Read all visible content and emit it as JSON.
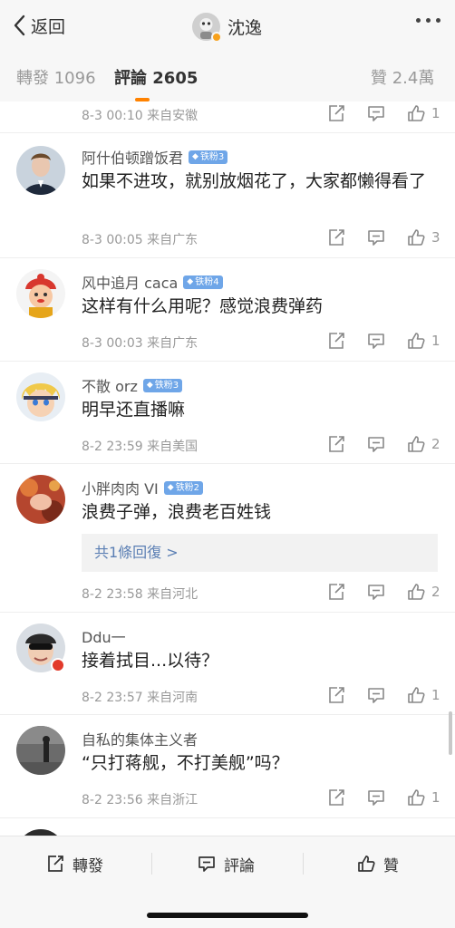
{
  "header": {
    "back_label": "返回",
    "title": "沈逸"
  },
  "tabs": [
    {
      "label": "轉發 1096"
    },
    {
      "label": "評論 2605"
    },
    {
      "label": "贊 2.4萬"
    }
  ],
  "top_partial": {
    "meta": "8-3 00:10 来自安徽",
    "likes": "1"
  },
  "comments": [
    {
      "name": "阿什伯顿蹭饭君",
      "fan": "铁粉3",
      "text": "如果不进攻，就别放烟花了，大家都懒得看了",
      "meta": "8-3 00:05 来自广东",
      "likes": "3"
    },
    {
      "name": "风中追月 caca",
      "fan": "铁粉4",
      "text": "这样有什么用呢？感觉浪费弹药",
      "meta": "8-3 00:03 来自广东",
      "likes": "1"
    },
    {
      "name": "不散 orz",
      "fan": "铁粉3",
      "text": "明早还直播嘛",
      "meta": "8-2 23:59 来自美国",
      "likes": "2"
    },
    {
      "name": "小胖肉肉 VI",
      "fan": "铁粉2",
      "text": "浪费子弹，浪费老百姓钱",
      "replies": "共1條回復 >",
      "meta": "8-2 23:58 来自河北",
      "likes": "2"
    },
    {
      "name": "Ddu一",
      "text": "接着拭目...以待？",
      "meta": "8-2 23:57 来自河南",
      "likes": "1"
    },
    {
      "name": "自私的集体主义者",
      "text": "“只打蒋舰，不打美舰”吗？",
      "meta": "8-2 23:56 来自浙江",
      "likes": "1"
    }
  ],
  "bottom_bar": {
    "repost": "轉發",
    "comment": "評論",
    "like": "贊"
  }
}
